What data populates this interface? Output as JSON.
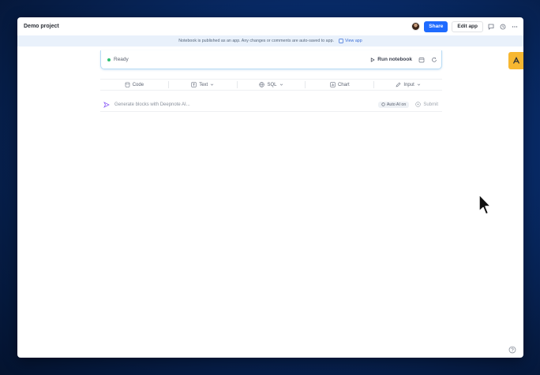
{
  "topbar": {
    "project_title": "Demo project",
    "share_label": "Share",
    "edit_app_label": "Edit app",
    "icons": [
      "avatar",
      "comment-icon",
      "history-icon",
      "more-icon"
    ]
  },
  "banner": {
    "message": "Notebook is published as an app. Any changes or comments are auto-saved to app.",
    "link_label": "View app"
  },
  "notebook": {
    "status": "Ready",
    "run_label": "Run notebook"
  },
  "blocks": {
    "items": [
      {
        "label": "Code",
        "icon": "database-icon",
        "dropdown": false
      },
      {
        "label": "Text",
        "icon": "text-icon",
        "dropdown": true
      },
      {
        "label": "SQL",
        "icon": "globe-icon",
        "dropdown": true
      },
      {
        "label": "Chart",
        "icon": "chart-icon",
        "dropdown": false
      },
      {
        "label": "Input",
        "icon": "pencil-icon",
        "dropdown": true
      }
    ]
  },
  "ai": {
    "placeholder": "Generate blocks with Deepnote AI...",
    "auto_label": "Auto AI on",
    "submit_label": "Submit"
  },
  "colors": {
    "accent": "#1f6bff",
    "side_tab": "#f7b731",
    "ready": "#2fbf71",
    "banner_bg": "#e9f1fb"
  }
}
